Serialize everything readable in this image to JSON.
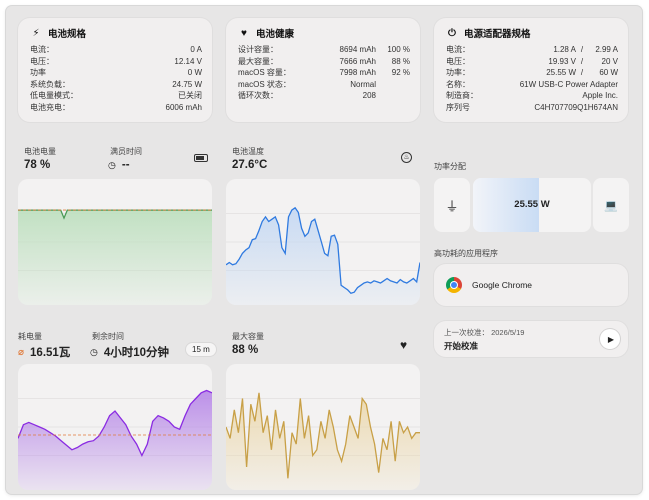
{
  "battery_spec": {
    "title": "电池规格",
    "rows": [
      {
        "label": "电流：",
        "value": "0 A"
      },
      {
        "label": "电压：",
        "value": "12.14 V"
      },
      {
        "label": "功率",
        "value": "0 W"
      },
      {
        "label": "系统负载：",
        "value": "24.75 W"
      },
      {
        "label": "低电量模式：",
        "value": "已关闭"
      },
      {
        "label": "电池充电：",
        "value": "6006 mAh"
      }
    ]
  },
  "battery_health": {
    "title": "电池健康",
    "rows": [
      {
        "label": "设计容量：",
        "value": "8694 mAh",
        "extra": "100 %"
      },
      {
        "label": "最大容量：",
        "value": "7666 mAh",
        "extra": "88 %"
      },
      {
        "label": "macOS 容量：",
        "value": "7998 mAh",
        "extra": "92 %"
      },
      {
        "label": "macOS 状态：",
        "value": "Normal",
        "extra": ""
      },
      {
        "label": "循环次数：",
        "value": "208",
        "extra": ""
      }
    ]
  },
  "adapter_spec": {
    "title": "电源适配器规格",
    "rows": [
      {
        "label": "电流：",
        "value": "1.28 A",
        "extra_prefix": "/",
        "extra": "2.99 A"
      },
      {
        "label": "电压：",
        "value": "19.93 V",
        "extra_prefix": "/",
        "extra": "20 V"
      },
      {
        "label": "功率：",
        "value": "25.55 W",
        "extra_prefix": "/",
        "extra": "60 W"
      },
      {
        "label": "名称：",
        "value": "61W USB-C Power Adapter",
        "extra_prefix": "",
        "extra": ""
      },
      {
        "label": "制造商：",
        "value": "Apple Inc.",
        "extra_prefix": "",
        "extra": ""
      },
      {
        "label": "序列号",
        "value": "C4H707709Q1H674AN",
        "extra_prefix": "",
        "extra": ""
      }
    ]
  },
  "battery_level": {
    "label": "电池电量",
    "value": "78 %"
  },
  "full_time": {
    "label": "满员时间",
    "value": "--"
  },
  "battery_temp": {
    "label": "电池温度",
    "value": "27.6°C"
  },
  "power_distribution": {
    "label": "功率分配",
    "value": "25.55 W",
    "fill_fraction": 0.56
  },
  "top_apps": {
    "label": "高功耗的应用程序",
    "app_name": "Google Chrome"
  },
  "drain": {
    "label": "耗电量",
    "value": "16.51瓦"
  },
  "remaining": {
    "label": "剩余时间",
    "value": "4小时10分钟",
    "interval": "15 m"
  },
  "max_capacity": {
    "label": "最大容量",
    "value": "88 %"
  },
  "calibration": {
    "last_label": "上一次校准：",
    "last_date": "2026/5/19",
    "action": "开始校准"
  },
  "colors": {
    "green_line": "#4a9a55",
    "green_fill": "#bfe0c0",
    "blue_line": "#2f7ae0",
    "blue_fill": "#c6d9f3",
    "purple_line": "#8a2be2",
    "purple_fill": "#b98be8",
    "gold_line": "#c8a047",
    "gold_fill": "#ecd9ae",
    "dashed": "#e07a3a"
  },
  "chart_data": [
    {
      "type": "area",
      "series": [
        {
          "values": [
            78,
            78,
            78,
            78,
            78,
            78,
            78,
            78,
            78,
            78,
            78,
            78,
            78,
            78,
            71,
            78,
            78,
            78,
            78,
            78,
            78,
            78,
            78,
            78,
            78,
            78,
            78,
            78,
            78,
            78,
            78,
            78,
            78,
            78,
            78,
            78,
            78,
            78,
            78,
            78,
            78,
            78,
            78,
            78,
            78,
            78,
            78,
            78,
            78,
            78,
            78,
            78,
            78,
            78,
            78,
            78,
            78,
            78,
            78,
            78
          ]
        }
      ],
      "ylim": [
        0,
        100
      ],
      "reference_line": 78
    },
    {
      "type": "area",
      "series": [
        {
          "values": [
            30,
            32,
            30,
            31,
            35,
            40,
            43,
            45,
            52,
            53,
            60,
            68,
            72,
            68,
            70,
            72,
            65,
            45,
            40,
            72,
            78,
            80,
            76,
            62,
            55,
            58,
            68,
            70,
            60,
            50,
            40,
            38,
            55,
            56,
            48,
            12,
            10,
            8,
            5,
            6,
            10,
            12,
            14,
            15,
            14,
            16,
            15,
            14,
            16,
            18,
            16,
            15,
            14,
            17,
            15,
            14,
            16,
            18,
            15,
            32
          ]
        }
      ],
      "ylim": [
        0,
        100
      ]
    },
    {
      "type": "area",
      "series": [
        {
          "values": [
            40,
            52,
            54,
            52,
            50,
            48,
            45,
            42,
            38,
            34,
            30,
            32,
            35,
            37,
            38,
            42,
            50,
            60,
            64,
            58,
            52,
            42,
            35,
            25,
            35,
            55,
            60,
            58,
            55,
            50,
            48,
            60,
            70,
            75,
            80,
            82,
            80
          ]
        }
      ],
      "ylim": [
        0,
        100
      ],
      "reference_line": 43
    },
    {
      "type": "area",
      "series": [
        {
          "values": [
            50,
            40,
            65,
            45,
            75,
            15,
            70,
            55,
            80,
            45,
            60,
            30,
            65,
            40,
            55,
            5,
            45,
            35,
            75,
            40,
            60,
            25,
            30,
            55,
            40,
            65,
            50,
            30,
            20,
            35,
            60,
            50,
            40,
            75,
            70,
            50,
            35,
            10,
            40,
            30,
            55,
            20,
            55,
            45,
            50,
            40,
            45,
            45
          ]
        }
      ],
      "ylim": [
        0,
        100
      ]
    }
  ]
}
